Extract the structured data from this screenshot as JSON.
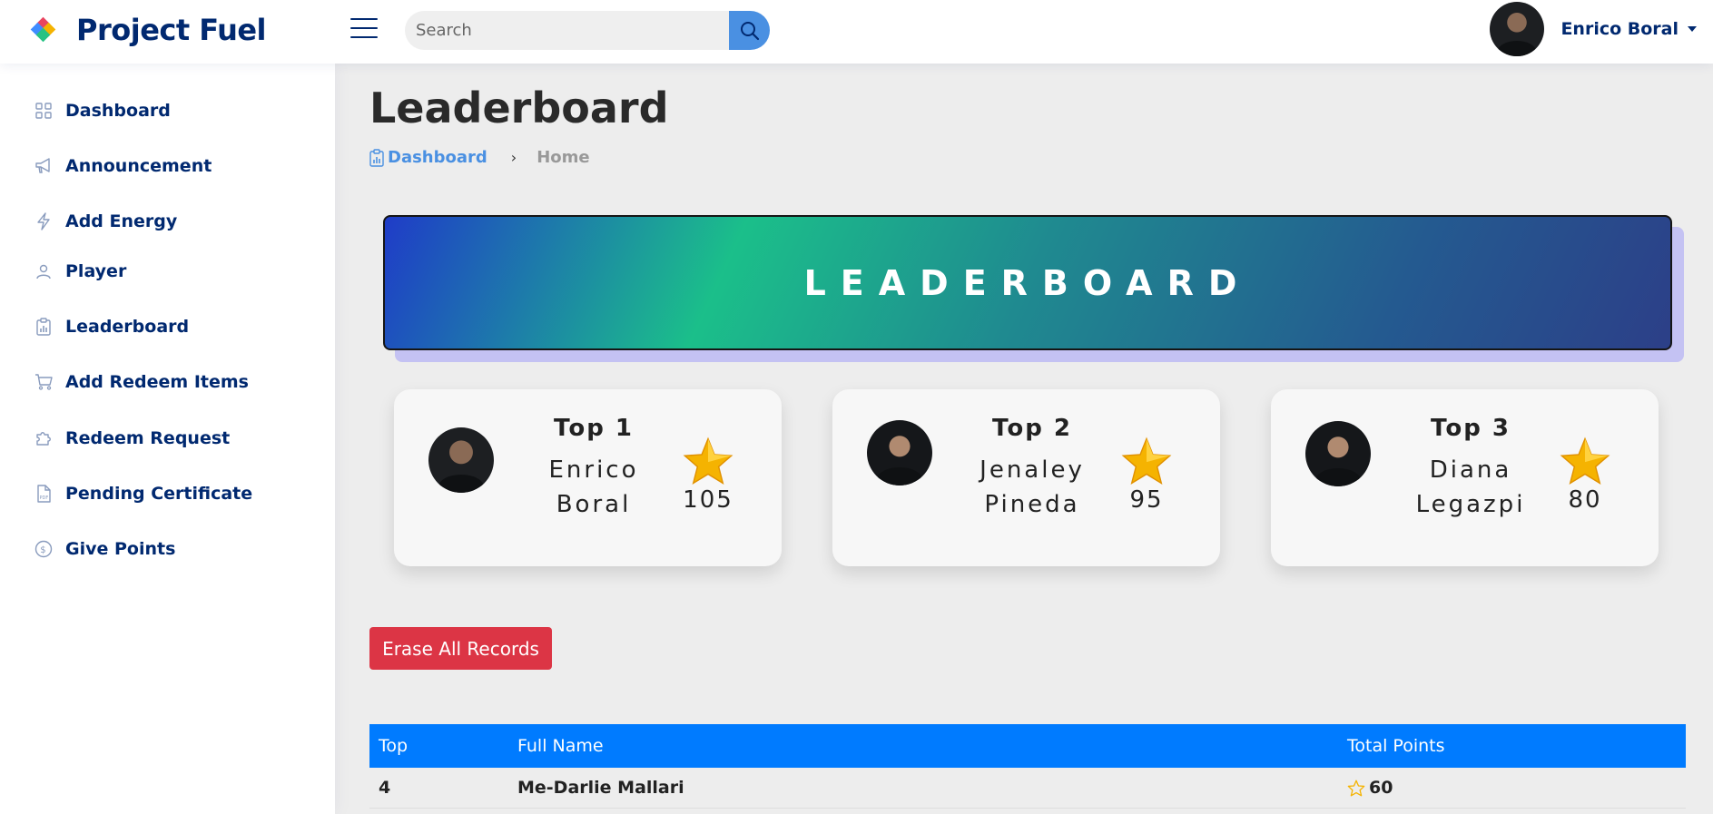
{
  "app": {
    "title": "Project Fuel"
  },
  "search": {
    "placeholder": "Search"
  },
  "user": {
    "name": "Enrico Boral"
  },
  "sidebar": {
    "items": [
      {
        "label": "Dashboard",
        "icon": "grid-icon"
      },
      {
        "label": "Announcement",
        "icon": "megaphone-icon"
      },
      {
        "label": "Add Energy",
        "icon": "lightning-icon"
      },
      {
        "label": "Player",
        "icon": "person-icon"
      },
      {
        "label": "Leaderboard",
        "icon": "clipboard-chart-icon"
      },
      {
        "label": "Add Redeem Items",
        "icon": "cart-icon"
      },
      {
        "label": "Redeem Request",
        "icon": "puzzle-icon"
      },
      {
        "label": "Pending Certificate",
        "icon": "pdf-file-icon"
      },
      {
        "label": "Give Points",
        "icon": "coin-icon"
      }
    ]
  },
  "page": {
    "title": "Leaderboard",
    "breadcrumb": {
      "link": "Dashboard",
      "separator": "›",
      "current": "Home"
    },
    "banner": "LEADERBOARD"
  },
  "top": [
    {
      "rank": "Top 1",
      "first": "Enrico",
      "last": "Boral",
      "points": "105"
    },
    {
      "rank": "Top 2",
      "first": "Jenaley",
      "last": "Pineda",
      "points": "95"
    },
    {
      "rank": "Top 3",
      "first": "Diana",
      "last": "Legazpi",
      "points": "80"
    }
  ],
  "actions": {
    "erase": "Erase All Records"
  },
  "table": {
    "headers": [
      "Top",
      "Full Name",
      "Total Points"
    ],
    "rows": [
      {
        "top": "4",
        "name": "Me-Darlie Mallari",
        "points": "60"
      }
    ]
  },
  "colors": {
    "brand": "#012970",
    "accent": "#4a90e2",
    "danger": "#dc3545",
    "table_header": "#007bff",
    "star": "#f5b301"
  }
}
